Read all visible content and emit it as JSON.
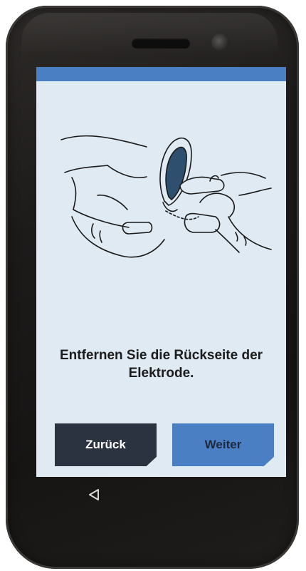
{
  "screen": {
    "instruction": "Entfernen Sie die Rückseite der Elektrode.",
    "illustration_icon": "peel-electrode-backing-icon"
  },
  "buttons": {
    "back_label": "Zurück",
    "next_label": "Weiter"
  },
  "nav": {
    "back_icon": "triangle-back-icon"
  },
  "colors": {
    "status_bar": "#4a7fc4",
    "screen_background": "#dfeaf2",
    "back_button": "#2b3240",
    "next_button": "#4a7fc4"
  }
}
